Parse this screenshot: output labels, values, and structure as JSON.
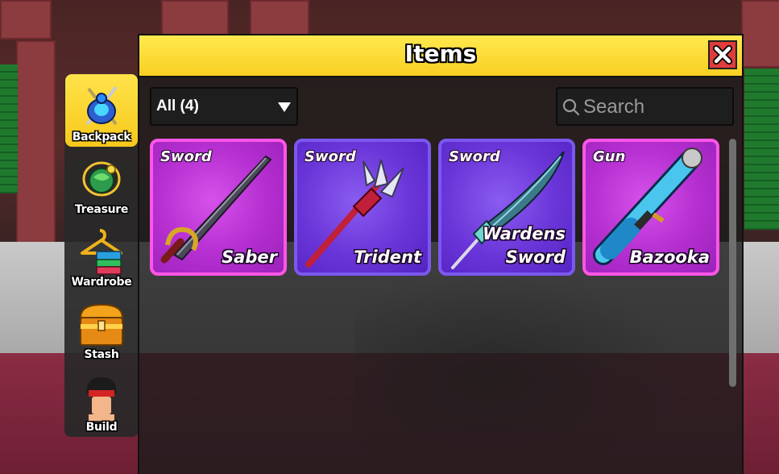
{
  "window": {
    "title": "Items",
    "close_label": "close"
  },
  "sidebar": {
    "items": [
      {
        "label": "Backpack",
        "icon": "backpack-icon",
        "active": true
      },
      {
        "label": "Treasure",
        "icon": "treasure-icon",
        "active": false
      },
      {
        "label": "Wardrobe",
        "icon": "wardrobe-icon",
        "active": false
      },
      {
        "label": "Stash",
        "icon": "stash-chest-icon",
        "active": false
      },
      {
        "label": "Build",
        "icon": "build-avatar-icon",
        "active": false
      }
    ]
  },
  "filter": {
    "selected": "All (4)"
  },
  "search": {
    "placeholder": "Search",
    "value": ""
  },
  "items": [
    {
      "type": "Sword",
      "name": "Saber",
      "rarity_color": "#ff56e7",
      "icon": "saber-icon"
    },
    {
      "type": "Sword",
      "name": "Trident",
      "rarity_color": "#7b58ee",
      "icon": "trident-icon"
    },
    {
      "type": "Sword",
      "name": "Wardens Sword",
      "rarity_color": "#7b58ee",
      "icon": "wardens-sword-icon"
    },
    {
      "type": "Gun",
      "name": "Bazooka",
      "rarity_color": "#ff56e7",
      "icon": "bazooka-icon"
    }
  ],
  "colors": {
    "title_bar": "#f9cf22",
    "close_button": "#e03c3c",
    "nav_active": "#f7c81c",
    "card_pink": "#b42ed0",
    "card_purple": "#6a35d8"
  }
}
